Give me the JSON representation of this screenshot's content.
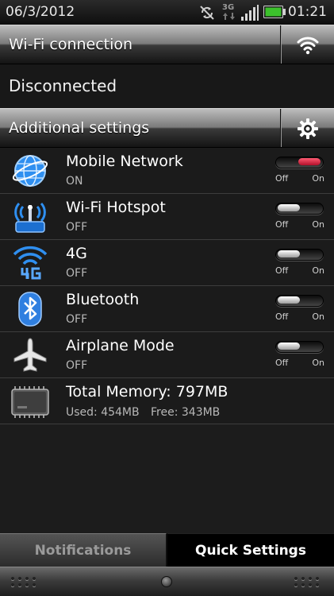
{
  "status_bar": {
    "date": "06/3/2012",
    "time": "01:21",
    "network_type": "3G",
    "icons": [
      "sync-off-icon",
      "data-3g-icon",
      "signal-icon",
      "battery-icon"
    ],
    "battery_color": "#3cc12c"
  },
  "wifi": {
    "header": "Wi-Fi connection",
    "status": "Disconnected",
    "button_icon": "wifi-icon"
  },
  "additional": {
    "header": "Additional settings",
    "button_icon": "gear-icon"
  },
  "toggle_labels": {
    "off": "Off",
    "on": "On"
  },
  "settings": [
    {
      "name": "Mobile Network",
      "state": "ON",
      "enabled": true,
      "icon": "globe-icon"
    },
    {
      "name": "Wi-Fi Hotspot",
      "state": "OFF",
      "enabled": false,
      "icon": "hotspot-icon"
    },
    {
      "name": "4G",
      "state": "OFF",
      "enabled": false,
      "icon": "4g-icon"
    },
    {
      "name": "Bluetooth",
      "state": "OFF",
      "enabled": false,
      "icon": "bluetooth-icon"
    },
    {
      "name": "Airplane Mode",
      "state": "OFF",
      "enabled": false,
      "icon": "airplane-icon"
    }
  ],
  "memory": {
    "title": "Total Memory: 797MB",
    "used": "Used: 454MB",
    "free": "Free: 343MB",
    "icon": "memory-chip-icon"
  },
  "tabs": {
    "notifications": "Notifications",
    "quick_settings": "Quick Settings",
    "active": "quick_settings"
  },
  "colors": {
    "toggle_on": "#d41a38",
    "icon_blue": "#2f8ff0"
  }
}
